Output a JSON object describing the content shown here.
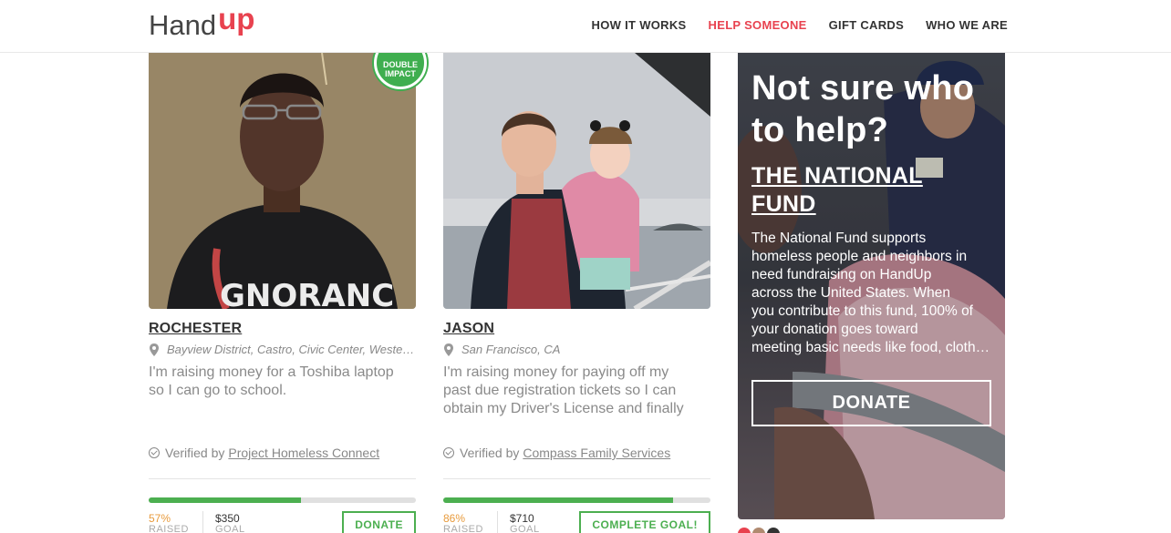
{
  "header": {
    "logo_hand": "Hand",
    "logo_up": "up",
    "nav": [
      {
        "label": "HOW IT WORKS",
        "active": false
      },
      {
        "label": "HELP SOMEONE",
        "active": true
      },
      {
        "label": "GIFT CARDS",
        "active": false
      },
      {
        "label": "WHO WE ARE",
        "active": false
      }
    ]
  },
  "cards": [
    {
      "badge": [
        "DOUBLE",
        "IMPACT"
      ],
      "name": "ROCHESTER",
      "location": "Bayview District, Castro, Civic Center, Western Addition",
      "story_lines": [
        "I'm raising money for a Toshiba laptop",
        "so I can go to school."
      ],
      "verified_prefix": "Verified by",
      "verified_org": "Project Homeless Connect",
      "progress_percent": 57,
      "pct_label": "57%",
      "raised_label": "RAISED",
      "goal_amount": "$350",
      "goal_label": "GOAL",
      "button": "DONATE"
    },
    {
      "name": "JASON",
      "location": "San Francisco, CA",
      "story_lines": [
        "I'm raising money for paying off my",
        "past due registration tickets so I can",
        "obtain my Driver's License and finally"
      ],
      "verified_prefix": "Verified by",
      "verified_org": "Compass Family Services",
      "progress_percent": 86,
      "pct_label": "86%",
      "raised_label": "RAISED",
      "goal_amount": "$710",
      "goal_label": "GOAL",
      "button": "COMPLETE GOAL!"
    }
  ],
  "promo": {
    "question": [
      "Not sure who",
      "to help?"
    ],
    "fund_title": [
      "THE NATIONAL",
      "FUND"
    ],
    "description_lines": [
      "The National Fund supports",
      "homeless people and neighbors in",
      "need fundraising on HandUp",
      "across the United States. When",
      "you contribute to this fund, 100% of",
      "your donation goes toward",
      "meeting basic needs like food, clothing"
    ],
    "button": "DONATE"
  },
  "colors": {
    "brand_red": "#e8424f",
    "progress_green": "#4caf50",
    "percent_orange": "#e89b3c"
  }
}
